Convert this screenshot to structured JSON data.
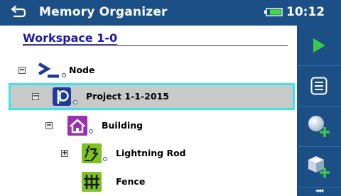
{
  "header": {
    "title": "Memory Organizer",
    "time": "10:12"
  },
  "workspace": {
    "title": "Workspace 1-0"
  },
  "tree": [
    {
      "label": "Node",
      "expander": "−",
      "icon": "node-icon"
    },
    {
      "label": "Project 1-1-2015",
      "expander": "−",
      "icon": "project-icon",
      "selected": true
    },
    {
      "label": "Building",
      "expander": "−",
      "icon": "building-icon"
    },
    {
      "label": "Lightning Rod",
      "expander": "+",
      "icon": "lightning-rod-icon"
    },
    {
      "label": "Fence",
      "expander": "",
      "icon": "fence-icon"
    }
  ],
  "sidebar": {
    "buttons": [
      "play-icon",
      "list-icon",
      "add-measurement-icon",
      "add-object-icon"
    ],
    "more_label": "◂◂◂"
  },
  "colors": {
    "header_bg": "#1b4f85",
    "selection_border": "#3ce4ef",
    "selection_bg": "#c9c9c9",
    "play_green": "#3cc84a"
  }
}
